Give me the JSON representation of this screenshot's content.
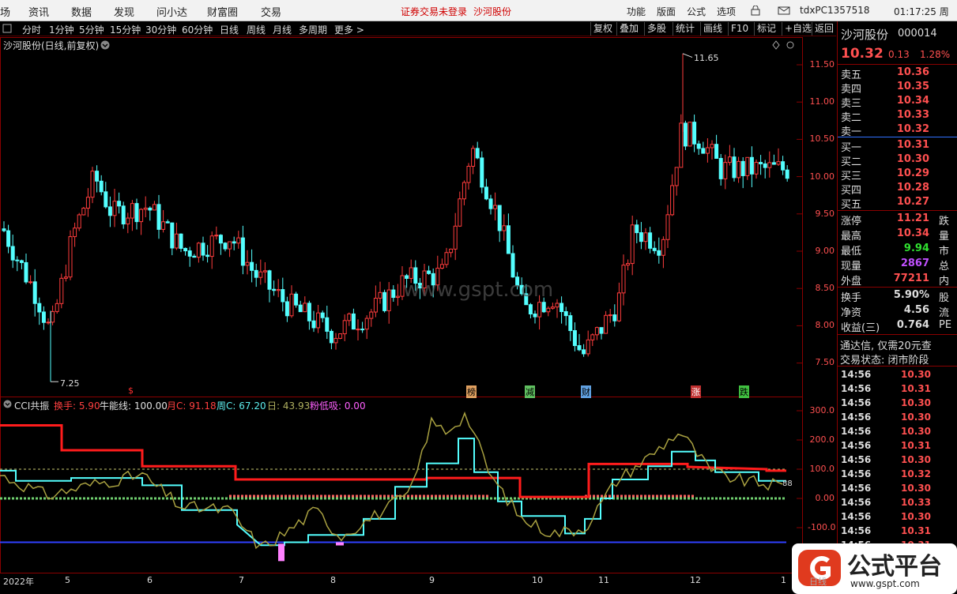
{
  "menu": {
    "items": [
      "场",
      "资讯",
      "数据",
      "发现",
      "问小达",
      "财富圈",
      "交易"
    ],
    "warning": "证券交易未登录",
    "stock_link": "沙河股份",
    "right_items": [
      "功能",
      "版面",
      "公式",
      "选项"
    ],
    "account": "tdxPC1357518",
    "clock": "01:17:25 周三"
  },
  "toolbar": {
    "periods": [
      "分时",
      "1分钟",
      "5分钟",
      "15分钟",
      "30分钟",
      "60分钟",
      "日线",
      "周线",
      "月线",
      "多周期",
      "更多 >"
    ],
    "buttons": [
      "复权",
      "叠加",
      "多股",
      "统计",
      "画线",
      "F10",
      "标记",
      "+自选",
      "返回"
    ]
  },
  "chart": {
    "title": "沙河股份(日线,前复权)",
    "watermark": "www.gspt.com",
    "price_high_label": "11.65",
    "price_low_label": "7.25",
    "y_ticks": [
      "11.50",
      "11.00",
      "10.50",
      "10.00",
      "9.50",
      "9.00",
      "8.50",
      "8.00",
      "7.50"
    ],
    "markers": [
      "$",
      "榜",
      "减",
      "财",
      "涨",
      "跌"
    ]
  },
  "indicator": {
    "name": "CCI共振",
    "huanshou": "换手: 5.90",
    "niuneng": "牛能线: 100.00",
    "yuec": "月C: 91.18",
    "zhouc": "周C: 67.20",
    "ri": "日: 43.93",
    "fendixi": "粉低吸: 0.00",
    "y_ticks": [
      "300.0",
      "200.0",
      "100.0",
      "0.00",
      "-100.0"
    ],
    "right_val": "88"
  },
  "x_axis": [
    "2022年",
    "5",
    "6",
    "7",
    "8",
    "9",
    "10",
    "11",
    "12",
    "1"
  ],
  "quote": {
    "name": "沙河股份",
    "code": "000014",
    "price": "10.32",
    "change": "0.13",
    "pct": "1.28%",
    "sells": [
      {
        "label": "卖五",
        "price": "10.36"
      },
      {
        "label": "卖四",
        "price": "10.35"
      },
      {
        "label": "卖三",
        "price": "10.34"
      },
      {
        "label": "卖二",
        "price": "10.33"
      },
      {
        "label": "卖一",
        "price": "10.32"
      }
    ],
    "buys": [
      {
        "label": "买一",
        "price": "10.31"
      },
      {
        "label": "买二",
        "price": "10.30"
      },
      {
        "label": "买三",
        "price": "10.29"
      },
      {
        "label": "买四",
        "price": "10.28"
      },
      {
        "label": "买五",
        "price": "10.27"
      }
    ],
    "stats": [
      {
        "label": "涨停",
        "value": "11.21",
        "extra": "跌"
      },
      {
        "label": "最高",
        "value": "10.34",
        "extra": "量"
      },
      {
        "label": "最低",
        "value": "9.94",
        "extra": "市"
      },
      {
        "label": "现量",
        "value": "2867",
        "extra": "总"
      },
      {
        "label": "外盘",
        "value": "77211",
        "extra": "内"
      }
    ],
    "stats2": [
      {
        "label": "换手",
        "value": "5.90%",
        "extra": "股"
      },
      {
        "label": "净资",
        "value": "4.56",
        "extra": "流"
      },
      {
        "label": "收益(三)",
        "value": "0.764",
        "extra": "PE"
      }
    ],
    "promo": "通达信, 仅需20元查",
    "status": "交易状态: 闭市阶段"
  },
  "ticks": [
    {
      "t": "14:56",
      "p": "10.30"
    },
    {
      "t": "14:56",
      "p": "10.31"
    },
    {
      "t": "14:56",
      "p": "10.30"
    },
    {
      "t": "14:56",
      "p": "10.30"
    },
    {
      "t": "14:56",
      "p": "10.30"
    },
    {
      "t": "14:56",
      "p": "10.31"
    },
    {
      "t": "14:56",
      "p": "10.30"
    },
    {
      "t": "14:56",
      "p": "10.32"
    },
    {
      "t": "14:56",
      "p": "10.30"
    },
    {
      "t": "14:56",
      "p": "10.33"
    },
    {
      "t": "14:56",
      "p": "10.30"
    },
    {
      "t": "14:56",
      "p": "10.31"
    },
    {
      "t": "14:56",
      "p": "10.31"
    }
  ],
  "logo": {
    "text": "公式平台",
    "url": "www.gspt.com",
    "date_label": "日线"
  }
}
